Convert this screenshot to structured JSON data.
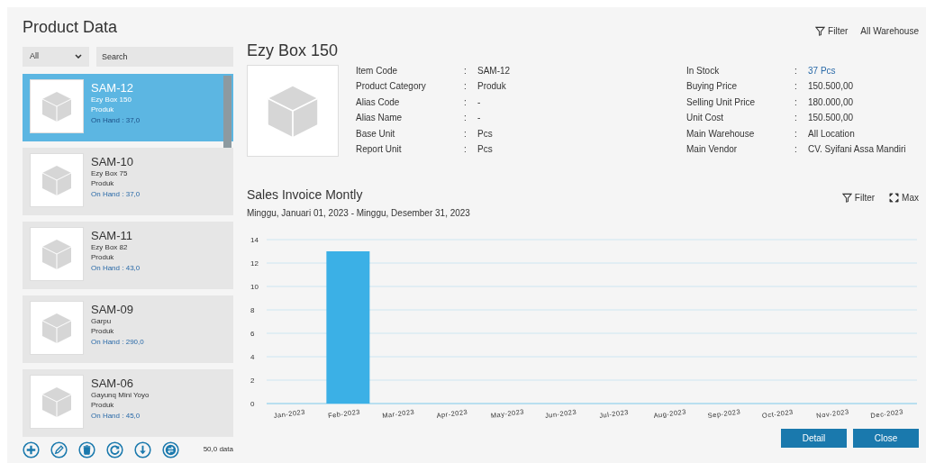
{
  "title": "Product Data",
  "list_filter": {
    "category": "All",
    "search_placeholder": "Search"
  },
  "products": [
    {
      "code": "SAM-12",
      "name": "Ezy Box 150",
      "category": "Produk",
      "on_hand": "On Hand : 37,0",
      "selected": true
    },
    {
      "code": "SAM-10",
      "name": "Ezy Box 75",
      "category": "Produk",
      "on_hand": "On Hand : 37,0",
      "selected": false
    },
    {
      "code": "SAM-11",
      "name": "Ezy Box 82",
      "category": "Produk",
      "on_hand": "On Hand : 43,0",
      "selected": false
    },
    {
      "code": "SAM-09",
      "name": "Garpu",
      "category": "Produk",
      "on_hand": "On Hand : 290,0",
      "selected": false
    },
    {
      "code": "SAM-06",
      "name": "Gayunq Mini Yoyo",
      "category": "Produk",
      "on_hand": "On Hand : 45,0",
      "selected": false
    }
  ],
  "list_footer": {
    "actions": [
      {
        "kind": "add"
      },
      {
        "kind": "edit"
      },
      {
        "kind": "delete"
      },
      {
        "kind": "refresh"
      },
      {
        "kind": "download"
      },
      {
        "kind": "swap"
      }
    ],
    "count": "50,0 data"
  },
  "toolbar": {
    "filter": "Filter",
    "warehouse": "All Warehouse"
  },
  "detail": {
    "title": "Ezy Box 150",
    "separator": ":",
    "left_fields": [
      {
        "label": "Item Code",
        "value": "SAM-12",
        "emphasis": false
      },
      {
        "label": "Product Category",
        "value": "Produk",
        "emphasis": false
      },
      {
        "label": "Alias Code",
        "value": "-",
        "emphasis": false
      },
      {
        "label": "Alias Name",
        "value": "-",
        "emphasis": false
      },
      {
        "label": "Base Unit",
        "value": "Pcs",
        "emphasis": false
      },
      {
        "label": "Report Unit",
        "value": "Pcs",
        "emphasis": false
      }
    ],
    "right_fields": [
      {
        "label": "In Stock",
        "value": "37 Pcs",
        "emphasis": true
      },
      {
        "label": "Buying Price",
        "value": "150.500,00",
        "emphasis": false
      },
      {
        "label": "Selling Unit Price",
        "value": "180.000,00",
        "emphasis": false
      },
      {
        "label": "Unit Cost",
        "value": "150.500,00",
        "emphasis": false
      },
      {
        "label": "Main Warehouse",
        "value": "All Location",
        "emphasis": false
      },
      {
        "label": "Main Vendor",
        "value": "CV. Syifani Assa Mandiri",
        "emphasis": false
      }
    ]
  },
  "sales_section": {
    "title": "Sales Invoice Montly",
    "range": "Minggu, Januari 01, 2023 - Minggu, Desember 31, 2023",
    "filter": "Filter",
    "max": "Max",
    "chart_data": {
      "type": "bar",
      "categories": [
        "Jan-2023",
        "Feb-2023",
        "Mar-2023",
        "Apr-2023",
        "May-2023",
        "Jun-2023",
        "Jul-2023",
        "Aug-2023",
        "Sep-2023",
        "Oct-2023",
        "Nov-2023",
        "Dec-2023"
      ],
      "series": [
        {
          "color": "#3bb0e6",
          "values": [
            0,
            13,
            0,
            0,
            0,
            0,
            0,
            0,
            0,
            0,
            0,
            0
          ]
        }
      ],
      "grid": true,
      "ylim": [
        0,
        14
      ],
      "yticks": [
        0,
        2,
        4,
        6,
        8,
        10,
        12,
        14
      ]
    }
  },
  "buttons": [
    "Detail",
    "Close"
  ]
}
